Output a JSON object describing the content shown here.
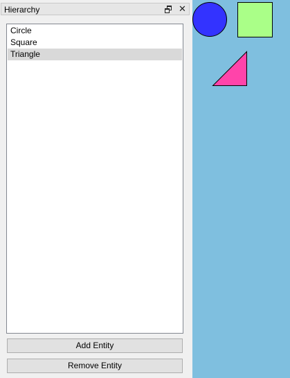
{
  "dock": {
    "title": "Hierarchy",
    "float_icon": "float-window-icon",
    "close_icon": "close-icon",
    "close_glyph": "✕"
  },
  "hierarchy": {
    "items": [
      {
        "label": "Circle",
        "selected": false
      },
      {
        "label": "Square",
        "selected": false
      },
      {
        "label": "Triangle",
        "selected": true
      }
    ]
  },
  "buttons": {
    "add_label": "Add Entity",
    "remove_label": "Remove Entity"
  },
  "scene": {
    "background": "#7fbfdf",
    "entities": [
      {
        "name": "Circle",
        "shape": "circle",
        "fill": "#3333ff",
        "stroke": "#000000"
      },
      {
        "name": "Square",
        "shape": "square",
        "fill": "#aaff88",
        "stroke": "#000000"
      },
      {
        "name": "Triangle",
        "shape": "triangle",
        "fill": "#ff44aa",
        "stroke": "#000000"
      }
    ]
  },
  "colors": {
    "selection": "#d9d9d9",
    "panel": "#f0f0f0"
  }
}
